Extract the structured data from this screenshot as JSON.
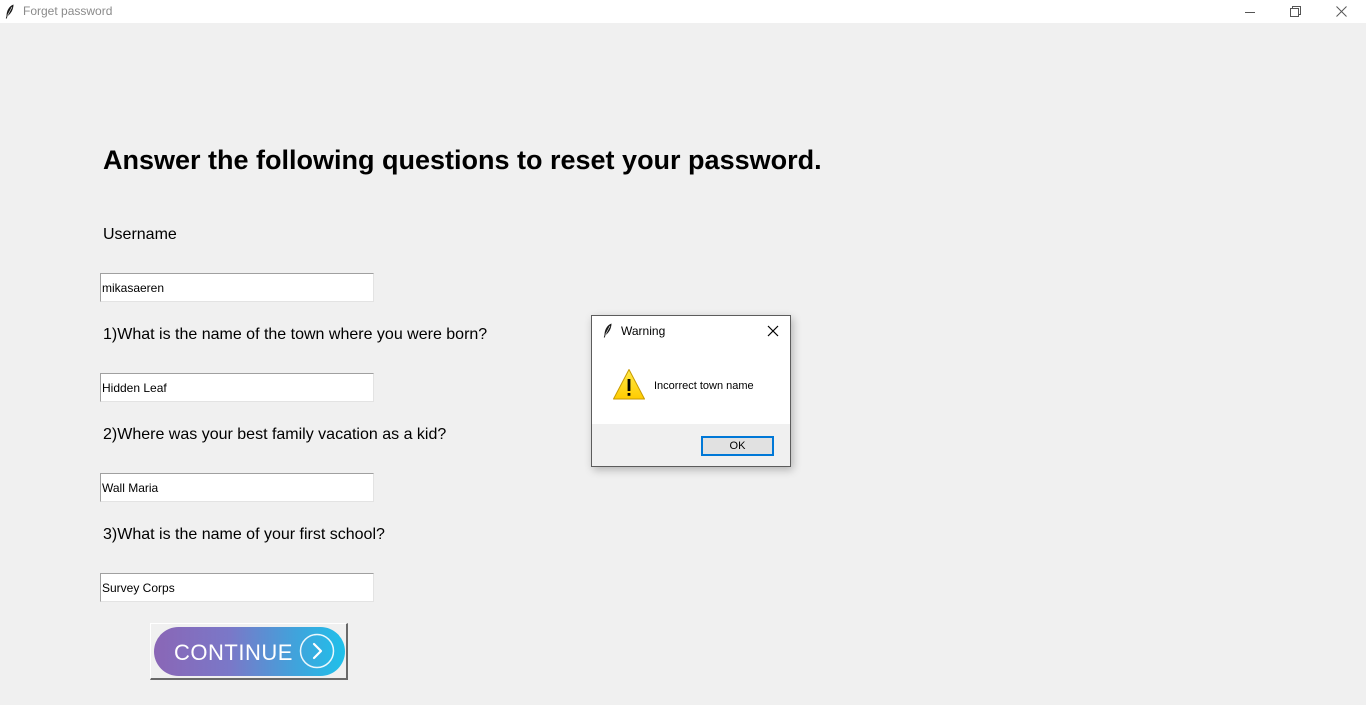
{
  "window": {
    "title": "Forget password",
    "app_icon": "feather-icon",
    "controls": [
      "minimize-icon",
      "maximize-icon",
      "close-icon"
    ]
  },
  "form": {
    "heading": "Answer the following questions to reset your password.",
    "username_label": "Username",
    "username_value": "mikasaeren",
    "q1_label": "1)What is the name of the town where you were born?",
    "q1_value": "Hidden Leaf",
    "q2_label": "2)Where was your best family vacation as a kid?",
    "q2_value": "Wall Maria",
    "q3_label": "3)What is the name of your first school?",
    "q3_value": "Survey Corps",
    "continue_label": "CONTINUE"
  },
  "dialog": {
    "title": "Warning",
    "icon": "warning-icon",
    "message": "Incorrect town name",
    "ok_label": "OK"
  },
  "colors": {
    "background": "#f0f0f0",
    "accent": "#0078d7",
    "warning_yellow": "#ffd800",
    "button_gradient_start": "#8a66b6",
    "button_gradient_end": "#1fc0ea"
  }
}
